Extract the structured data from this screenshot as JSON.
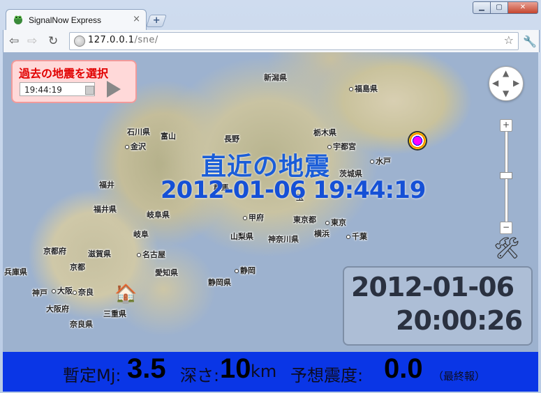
{
  "browser": {
    "tab_title": "SignalNow Express",
    "tab_close": "×",
    "new_tab": "+",
    "url_host": "127.0.0.1",
    "url_path": "/sne/",
    "icons": [
      "back-icon",
      "forward-icon",
      "reload-icon",
      "globe-icon",
      "star-icon",
      "wrench-icon"
    ]
  },
  "past_panel": {
    "label": "過去の地震を選択",
    "time_value": "19:44:19"
  },
  "map": {
    "title": "直近の地震",
    "event_time": "2012-01-06 19:44:19",
    "cities": [
      "新潟県",
      "福島県",
      "石川県",
      "富山",
      "長野",
      "栃木県",
      "金沢",
      "宇都宮",
      "水戸",
      "茨城県",
      "福井",
      "群馬",
      "玉",
      "福井県",
      "岐阜県",
      "甲府",
      "東京都",
      "東京",
      "岐阜",
      "山梨県",
      "横浜",
      "千葉",
      "京都府",
      "滋賀県",
      "名古屋",
      "神奈川県",
      "兵庫県",
      "京都",
      "愛知県",
      "静岡",
      "神戸",
      "大阪",
      "奈良",
      "静岡県",
      "大阪府",
      "三重県",
      "奈良県"
    ]
  },
  "clock": {
    "date": "2012-01-06",
    "time": "20:00:26"
  },
  "status": {
    "mj_label": "暫定Mj:",
    "mj_value": "3.5",
    "depth_label": "深さ:",
    "depth_value": "10",
    "depth_unit": "km",
    "intensity_label": "予想震度:",
    "intensity_value": "0.0",
    "final_note": "（最終報）"
  }
}
